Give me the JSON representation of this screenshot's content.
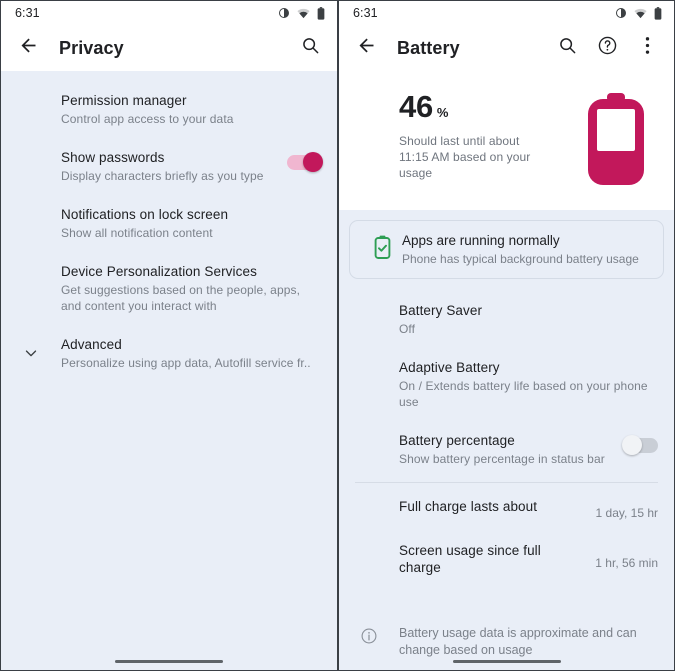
{
  "left_screen": {
    "status_bar": {
      "time": "6:31",
      "icons": [
        "dnd-icon",
        "wifi-icon",
        "battery-icon"
      ]
    },
    "app_bar": {
      "back_icon": "arrow-back-icon",
      "title": "Privacy",
      "search_icon": "search-icon"
    },
    "items": [
      {
        "title": "Permission manager",
        "subtitle": "Control app access to your data",
        "lead_icon": "",
        "control": "none",
        "value": ""
      },
      {
        "title": "Show passwords",
        "subtitle": "Display characters briefly as you type",
        "lead_icon": "",
        "control": "switch-on",
        "value": ""
      },
      {
        "title": "Notifications on lock screen",
        "subtitle": "Show all notification content",
        "lead_icon": "",
        "control": "none",
        "value": ""
      },
      {
        "title": "Device Personalization Services",
        "subtitle": "Get suggestions based on the people, apps, and content you interact with",
        "lead_icon": "",
        "control": "none",
        "value": ""
      },
      {
        "title": "Advanced",
        "subtitle": "Personalize using app data, Autofill service fr..",
        "lead_icon": "chevron-down-icon",
        "control": "none",
        "value": ""
      }
    ]
  },
  "right_screen": {
    "status_bar": {
      "time": "6:31",
      "icons": [
        "dnd-icon",
        "wifi-icon",
        "battery-icon"
      ]
    },
    "app_bar": {
      "back_icon": "arrow-back-icon",
      "title": "Battery",
      "search_icon": "search-icon",
      "help_icon": "help-circle-icon",
      "overflow_icon": "more-vert-icon"
    },
    "summary": {
      "percent": "46",
      "percent_symbol": "%",
      "note": "Should last until about 11:15 AM based on your usage",
      "graphic": "battery-large-icon",
      "graphic_color": "#c2185b",
      "fill_level": 46
    },
    "status_card": {
      "icon": "battery-check-icon",
      "icon_color": "#2e9e54",
      "title": "Apps are running normally",
      "subtitle": "Phone has typical background battery usage"
    },
    "items": [
      {
        "title": "Battery Saver",
        "subtitle": "Off",
        "control": "none",
        "value": ""
      },
      {
        "title": "Adaptive Battery",
        "subtitle": "On / Extends battery life based on your phone use",
        "control": "none",
        "value": ""
      },
      {
        "title": "Battery percentage",
        "subtitle": "Show battery percentage in status bar",
        "control": "switch-off",
        "value": ""
      }
    ],
    "stats": [
      {
        "title": "Full charge lasts about",
        "value": "1 day, 15 hr"
      },
      {
        "title": "Screen usage since full charge",
        "value": "1 hr, 56 min"
      }
    ],
    "footer": {
      "icon": "info-circle-icon",
      "text": "Battery usage data is approximate and can change based on usage"
    }
  },
  "colors": {
    "background": "#e9eef7",
    "surface": "#ffffff",
    "accent_pink": "#c2185b",
    "accent_pink_track": "#f0b6d0",
    "green": "#2e9e54",
    "text_primary": "#202124",
    "text_secondary": "#7b818a"
  }
}
